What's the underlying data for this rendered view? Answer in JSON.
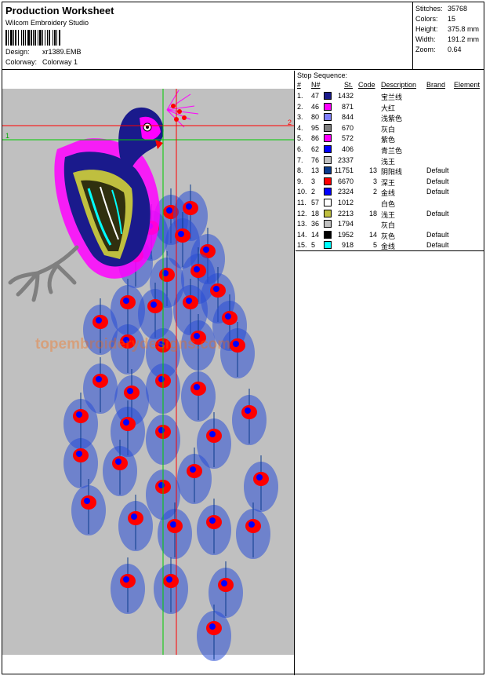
{
  "header": {
    "title": "Production Worksheet",
    "subtitle": "Wilcom Embroidery Studio",
    "design_label": "Design:",
    "design_value": "xr1389.EMB",
    "colorway_label": "Colorway:",
    "colorway_value": "Colorway 1"
  },
  "stats": [
    {
      "label": "Stitches:",
      "value": "35768"
    },
    {
      "label": "Colors:",
      "value": "15"
    },
    {
      "label": "Height:",
      "value": "375.8 mm"
    },
    {
      "label": "Width:",
      "value": "191.2 mm"
    },
    {
      "label": "Zoom:",
      "value": "0.64"
    }
  ],
  "design": {
    "watermark": "topembroiderydesigns.com",
    "marker_1": "1",
    "marker_2": "2"
  },
  "sequence": {
    "title": "Stop Sequence:",
    "columns": {
      "num": "#",
      "n": "N#",
      "st": "St.",
      "code": "Code",
      "desc": "Description",
      "brand": "Brand",
      "element": "Element"
    },
    "rows": [
      {
        "num": "1.",
        "n": "47",
        "color": "#1a1a8c",
        "st": "1432",
        "code": "",
        "desc": "宝兰线",
        "brand": ""
      },
      {
        "num": "2.",
        "n": "46",
        "color": "#ff00ff",
        "st": "871",
        "code": "",
        "desc": "大红",
        "brand": ""
      },
      {
        "num": "3.",
        "n": "80",
        "color": "#7f7fff",
        "st": "844",
        "code": "",
        "desc": "浅紫色",
        "brand": ""
      },
      {
        "num": "4.",
        "n": "95",
        "color": "#7f7f7f",
        "st": "670",
        "code": "",
        "desc": "灰白",
        "brand": ""
      },
      {
        "num": "5.",
        "n": "86",
        "color": "#ff00ff",
        "st": "572",
        "code": "",
        "desc": "紫色",
        "brand": ""
      },
      {
        "num": "6.",
        "n": "62",
        "color": "#0000ff",
        "st": "406",
        "code": "",
        "desc": "青兰色",
        "brand": ""
      },
      {
        "num": "7.",
        "n": "76",
        "color": "#c0c0c0",
        "st": "2337",
        "code": "",
        "desc": "浅王",
        "brand": ""
      },
      {
        "num": "8.",
        "n": "13",
        "color": "#0a3a8c",
        "st": "11751",
        "code": "13",
        "desc": "阴阳线",
        "brand": "Default"
      },
      {
        "num": "9.",
        "n": "3",
        "color": "#ff0000",
        "st": "6670",
        "code": "3",
        "desc": "深王",
        "brand": "Default"
      },
      {
        "num": "10.",
        "n": "2",
        "color": "#0000ff",
        "st": "2324",
        "code": "2",
        "desc": "金线",
        "brand": "Default"
      },
      {
        "num": "11.",
        "n": "57",
        "color": "#ffffff",
        "st": "1012",
        "code": "",
        "desc": "白色",
        "brand": ""
      },
      {
        "num": "12.",
        "n": "18",
        "color": "#bfbf3f",
        "st": "2213",
        "code": "18",
        "desc": "浅王",
        "brand": "Default"
      },
      {
        "num": "13.",
        "n": "36",
        "color": "#c0c0c0",
        "st": "1794",
        "code": "",
        "desc": "灰白",
        "brand": ""
      },
      {
        "num": "14.",
        "n": "14",
        "color": "#000000",
        "st": "1952",
        "code": "14",
        "desc": "灰色",
        "brand": "Default"
      },
      {
        "num": "15.",
        "n": "5",
        "color": "#00ffff",
        "st": "918",
        "code": "5",
        "desc": "金线",
        "brand": "Default"
      }
    ]
  }
}
